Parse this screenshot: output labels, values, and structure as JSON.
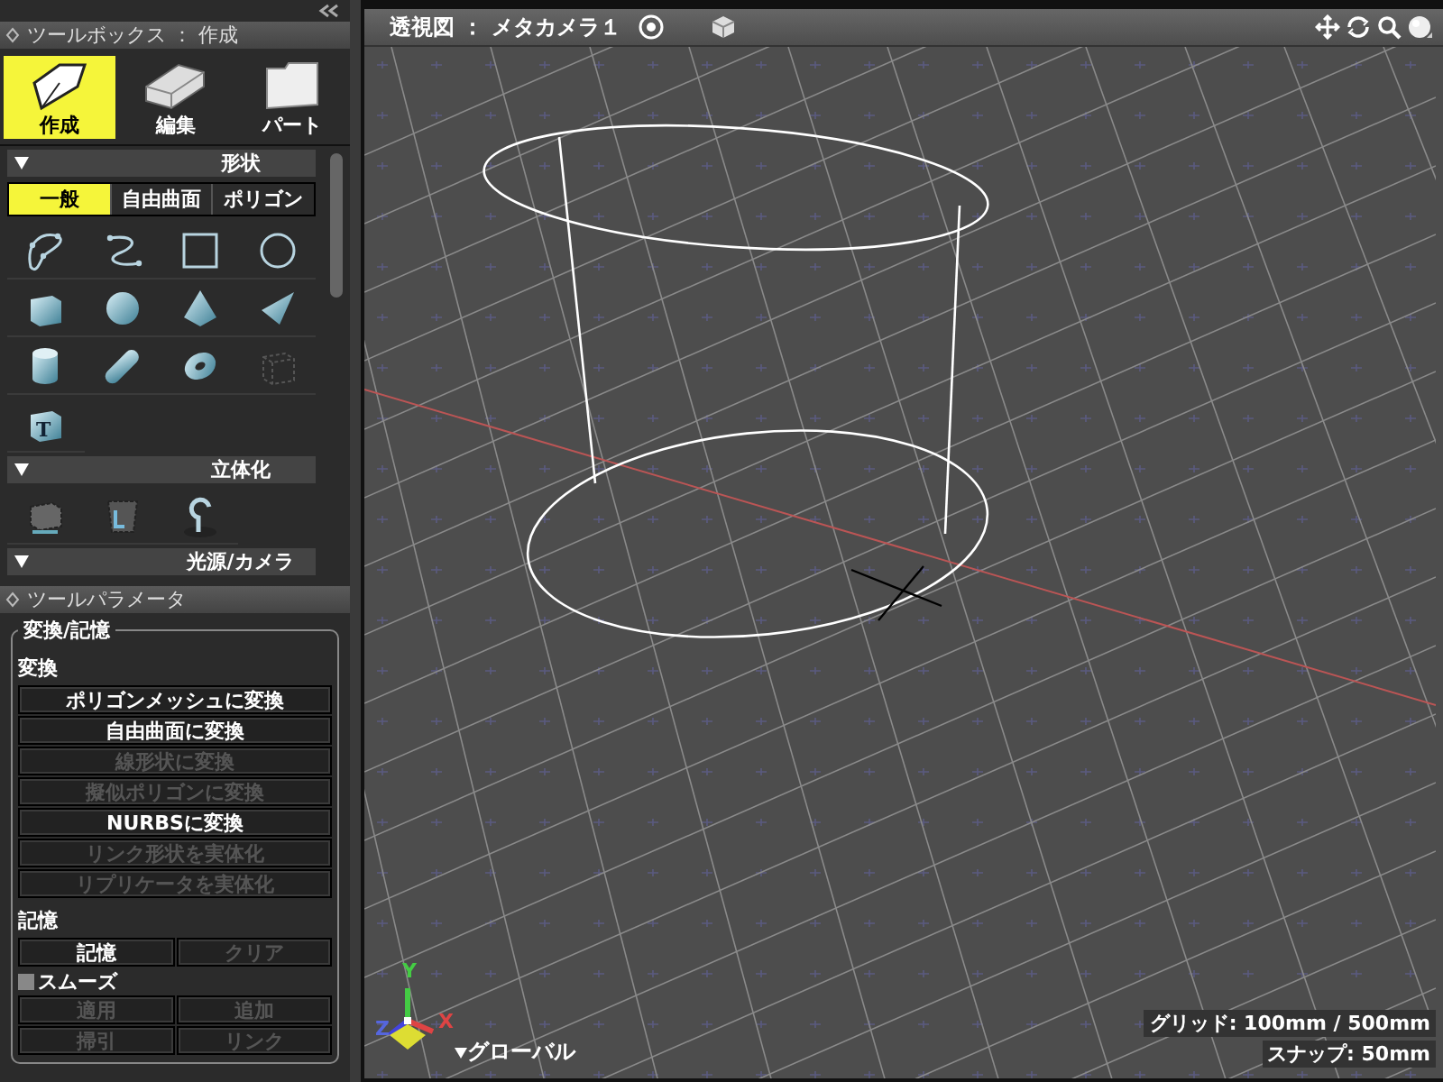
{
  "toolbox": {
    "title": "ツールボックス ： 作成",
    "modes": [
      {
        "label": "作成",
        "kind": "pen",
        "selected": true
      },
      {
        "label": "編集",
        "kind": "eraser",
        "selected": false
      },
      {
        "label": "パート",
        "kind": "folder",
        "selected": false
      }
    ],
    "sections": [
      {
        "title": "形状",
        "subtabs": [
          {
            "label": "一般",
            "selected": true
          },
          {
            "label": "自由曲面",
            "selected": false
          },
          {
            "label": "ポリゴン",
            "selected": false
          }
        ],
        "tools": [
          {
            "kind": "closed_curve"
          },
          {
            "kind": "open_curve"
          },
          {
            "kind": "rectangle"
          },
          {
            "kind": "circle"
          },
          {
            "kind": "box"
          },
          {
            "kind": "sphere"
          },
          {
            "kind": "pyramid"
          },
          {
            "kind": "cone"
          },
          {
            "kind": "cylinder"
          },
          {
            "kind": "capsule"
          },
          {
            "kind": "torus"
          },
          {
            "kind": "dashed_box"
          },
          {
            "kind": "text_box",
            "label": "T"
          }
        ]
      },
      {
        "title": "立体化",
        "tools": [
          {
            "kind": "extrude"
          },
          {
            "kind": "cup"
          },
          {
            "kind": "revolve"
          }
        ]
      },
      {
        "title": "光源/カメラ"
      }
    ]
  },
  "tool_parameters": {
    "title": "ツールパラメータ",
    "group": "変換/記憶",
    "convert": {
      "label": "変換",
      "buttons": [
        {
          "label": "ポリゴンメッシュに変換",
          "disabled": false
        },
        {
          "label": "自由曲面に変換",
          "disabled": false
        },
        {
          "label": "線形状に変換",
          "disabled": true
        },
        {
          "label": "擬似ポリゴンに変換",
          "disabled": true
        },
        {
          "label": "NURBSに変換",
          "disabled": false
        },
        {
          "label": "リンク形状を実体化",
          "disabled": true
        },
        {
          "label": "リプリケータを実体化",
          "disabled": true
        }
      ]
    },
    "memory": {
      "label": "記憶",
      "buttons": [
        {
          "label": "記憶",
          "disabled": false
        },
        {
          "label": "クリア",
          "disabled": true
        }
      ],
      "smooth": {
        "label": "スムーズ",
        "checked": false
      },
      "buttons_2": [
        {
          "label": "適用",
          "disabled": true
        },
        {
          "label": "追加",
          "disabled": true
        },
        {
          "label": "掃引",
          "disabled": true
        },
        {
          "label": "リンク",
          "disabled": true
        }
      ]
    }
  },
  "viewport": {
    "title": "透視図 ： メタカメラ１",
    "axis_labels": {
      "x": "X",
      "y": "Y",
      "z": "Z"
    },
    "coordinate_mode": "グローバル",
    "grid": "グリッド: 100mm / 500mm",
    "snap": "スナップ: 50mm"
  }
}
